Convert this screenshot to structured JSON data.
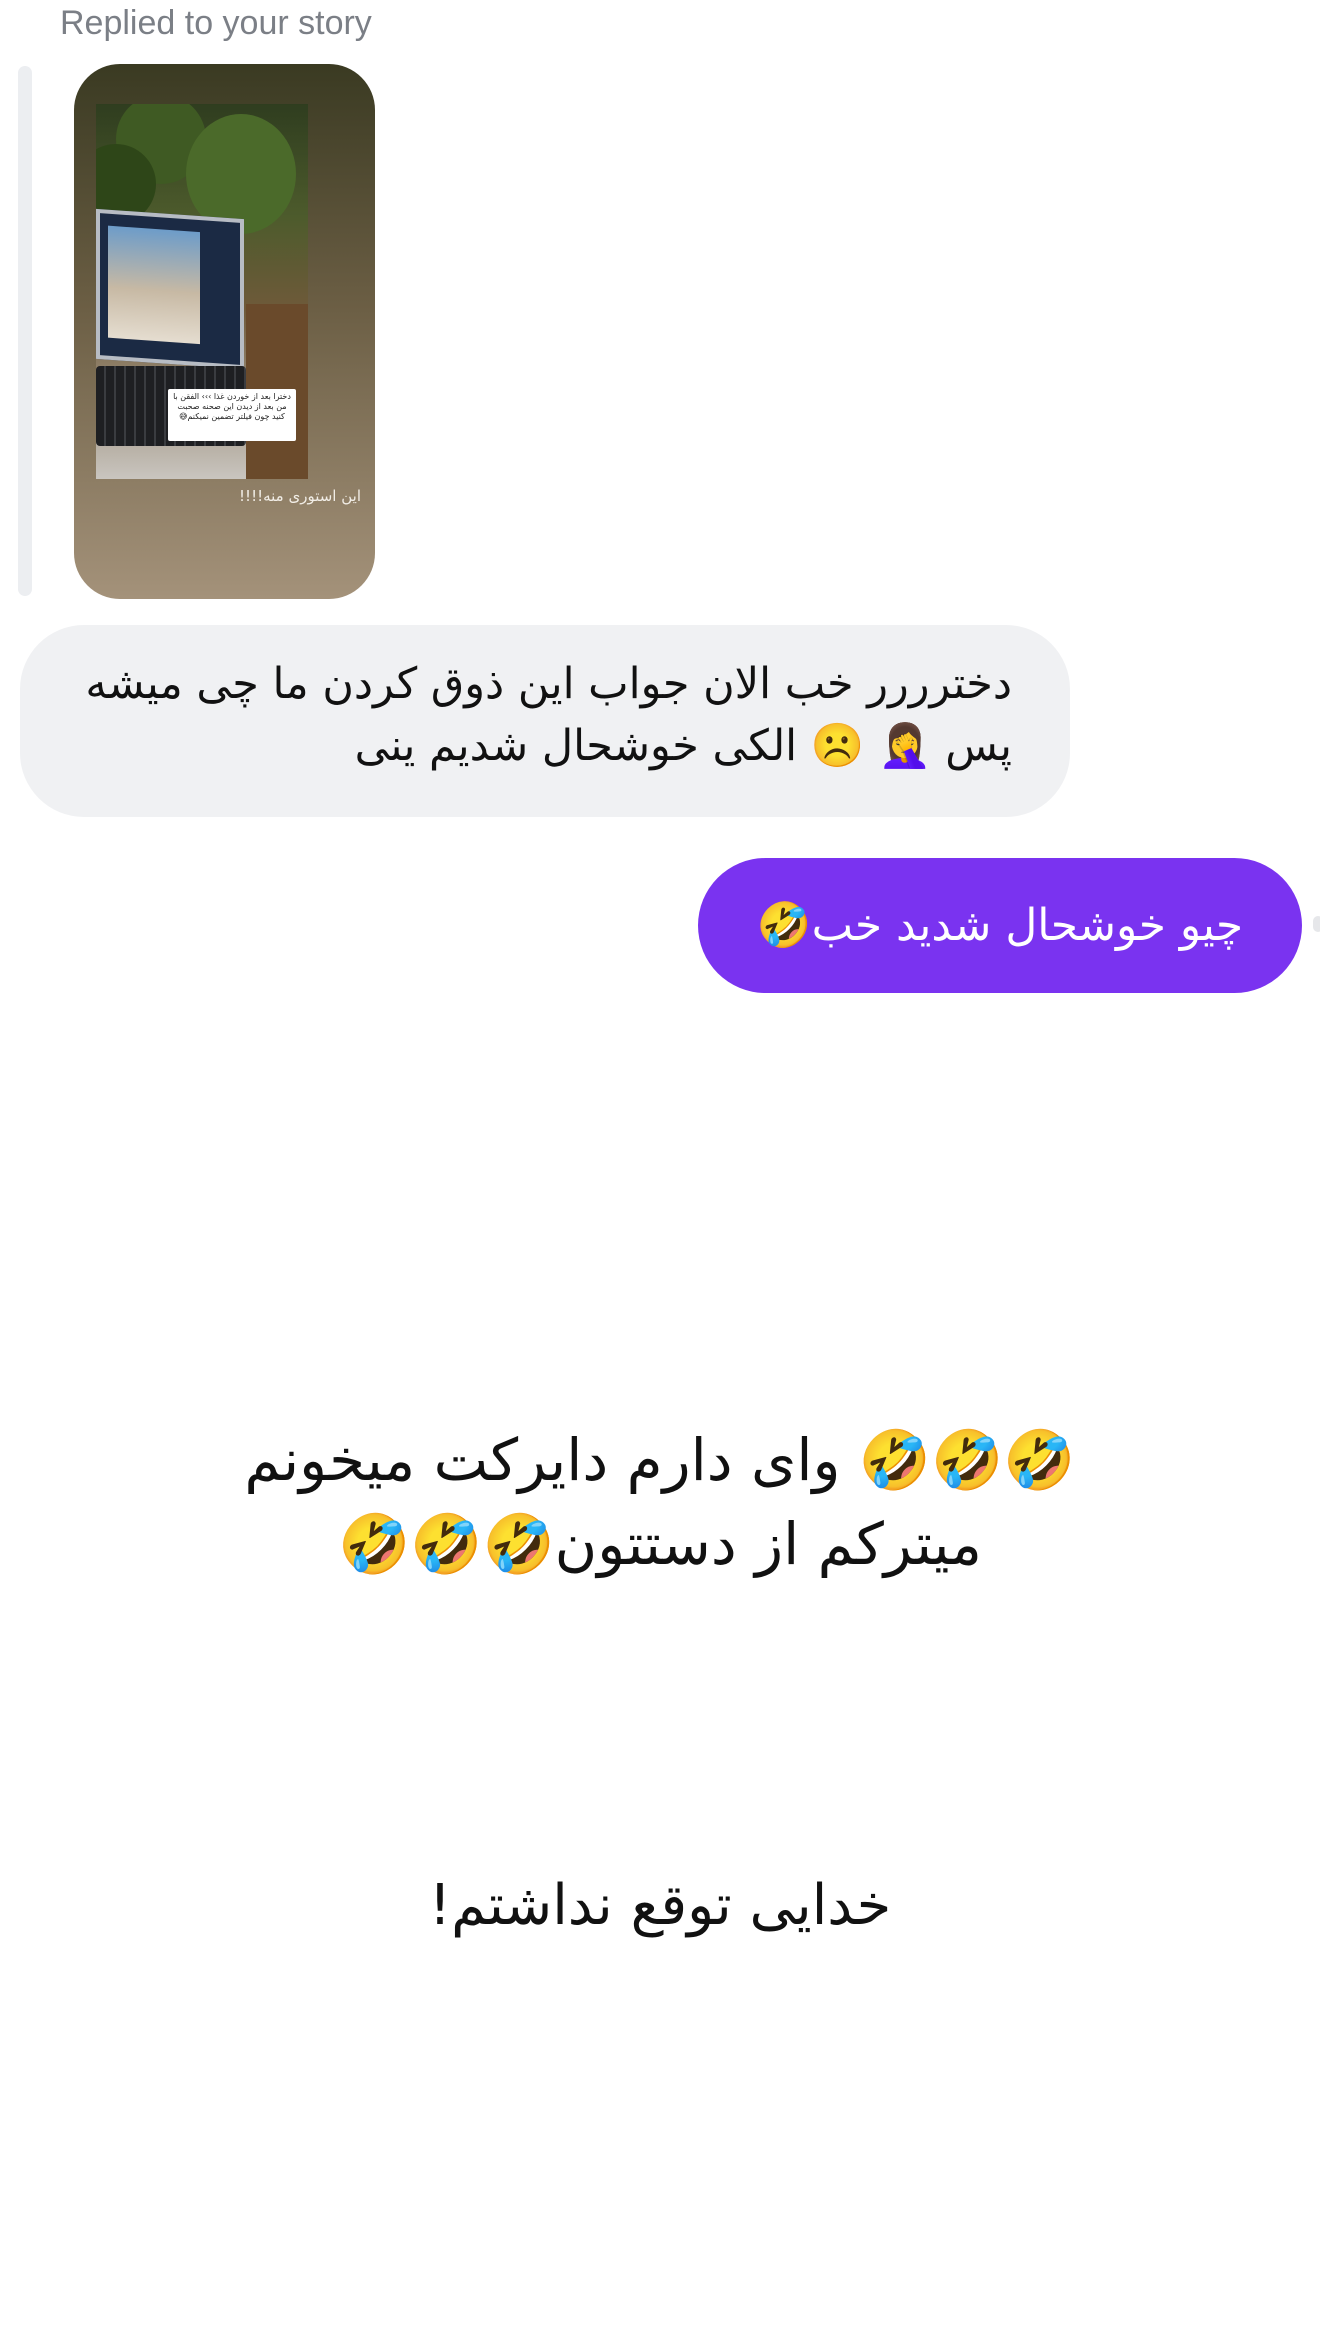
{
  "reply_label": "Replied to your story",
  "story": {
    "sticker_text": "دخترا بعد از خوردن غذا ››› الفقن با من بعد از دیدن این صحنه صحبت کنید چون فیلتر تضمین نمیکنم😅",
    "caption": "این استوری منه!!!!"
  },
  "messages": {
    "incoming": "دخترررر خب الان جواب این ذوق کردن ما چی میشه پس 🤦‍♀️ ☹️ الکی خوشحال شدیم ینی",
    "outgoing": "چیو خوشحال شدید خب🤣"
  },
  "overlay": {
    "exclaim": "🤣🤣🤣 وای دارم دایرکت میخونم میترکم از دستتون🤣🤣🤣",
    "note": "خدایی توقع نداشتم!"
  },
  "colors": {
    "outgoing_bubble": "#7a33f0",
    "incoming_bubble": "#f0f1f3",
    "label_gray": "#7b7f86"
  }
}
